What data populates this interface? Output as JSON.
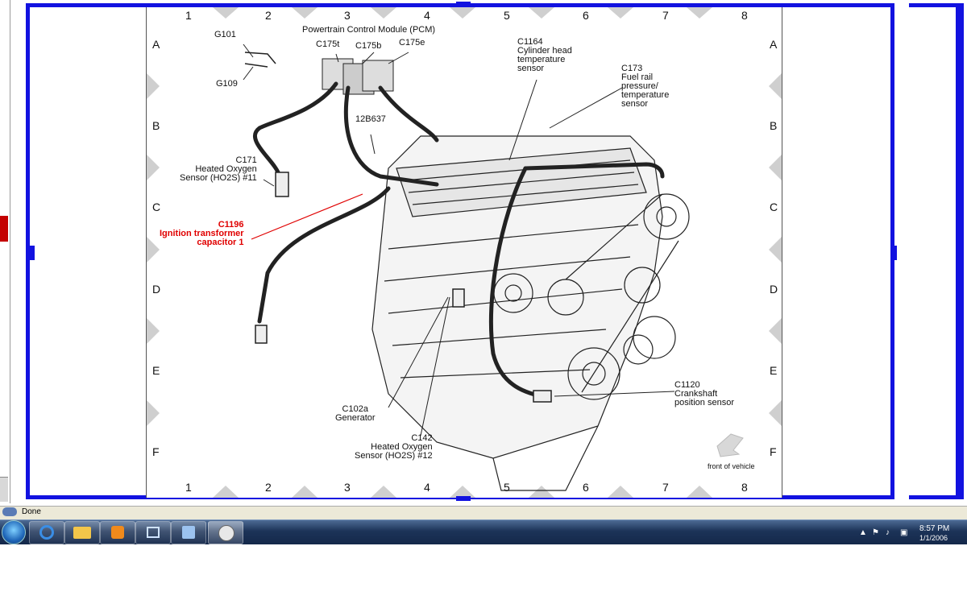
{
  "status": {
    "text": "Done"
  },
  "clock": {
    "time": "8:57 PM",
    "date": "1/1/2006"
  },
  "taskbar": {
    "apps": [
      "start-orb",
      "ie-icon",
      "explorer-icon",
      "media-player-icon",
      "network-icon",
      "calculator-icon",
      "diagram-viewer-icon"
    ]
  },
  "diagram": {
    "columns": [
      "1",
      "2",
      "3",
      "4",
      "5",
      "6",
      "7",
      "8"
    ],
    "rows": [
      "A",
      "B",
      "C",
      "D",
      "E",
      "F"
    ],
    "labels": {
      "pcm": "Powertrain Control Module (PCM)",
      "g101": "G101",
      "g109": "G109",
      "c175t": "C175t",
      "c175b": "C175b",
      "c175e": "C175e",
      "c1164": "C1164\nCylinder head\ntemperature\nsensor",
      "c173": "C173\nFuel rail\npressure/\ntemperature\nsensor",
      "harness_12b637": "12B637",
      "c171": "C171\nHeated Oxygen\nSensor (HO2S) #11",
      "c1196": "C1196\nIgnition transformer\ncapacitor 1",
      "c102a": "C102a\nGenerator",
      "c142": "C142\nHeated Oxygen\nSensor (HO2S) #12",
      "c1120": "C1120\nCrankshaft\nposition sensor",
      "front": "front of vehicle"
    },
    "highlight_color": "#e00000",
    "frame_color": "#1212e0"
  }
}
